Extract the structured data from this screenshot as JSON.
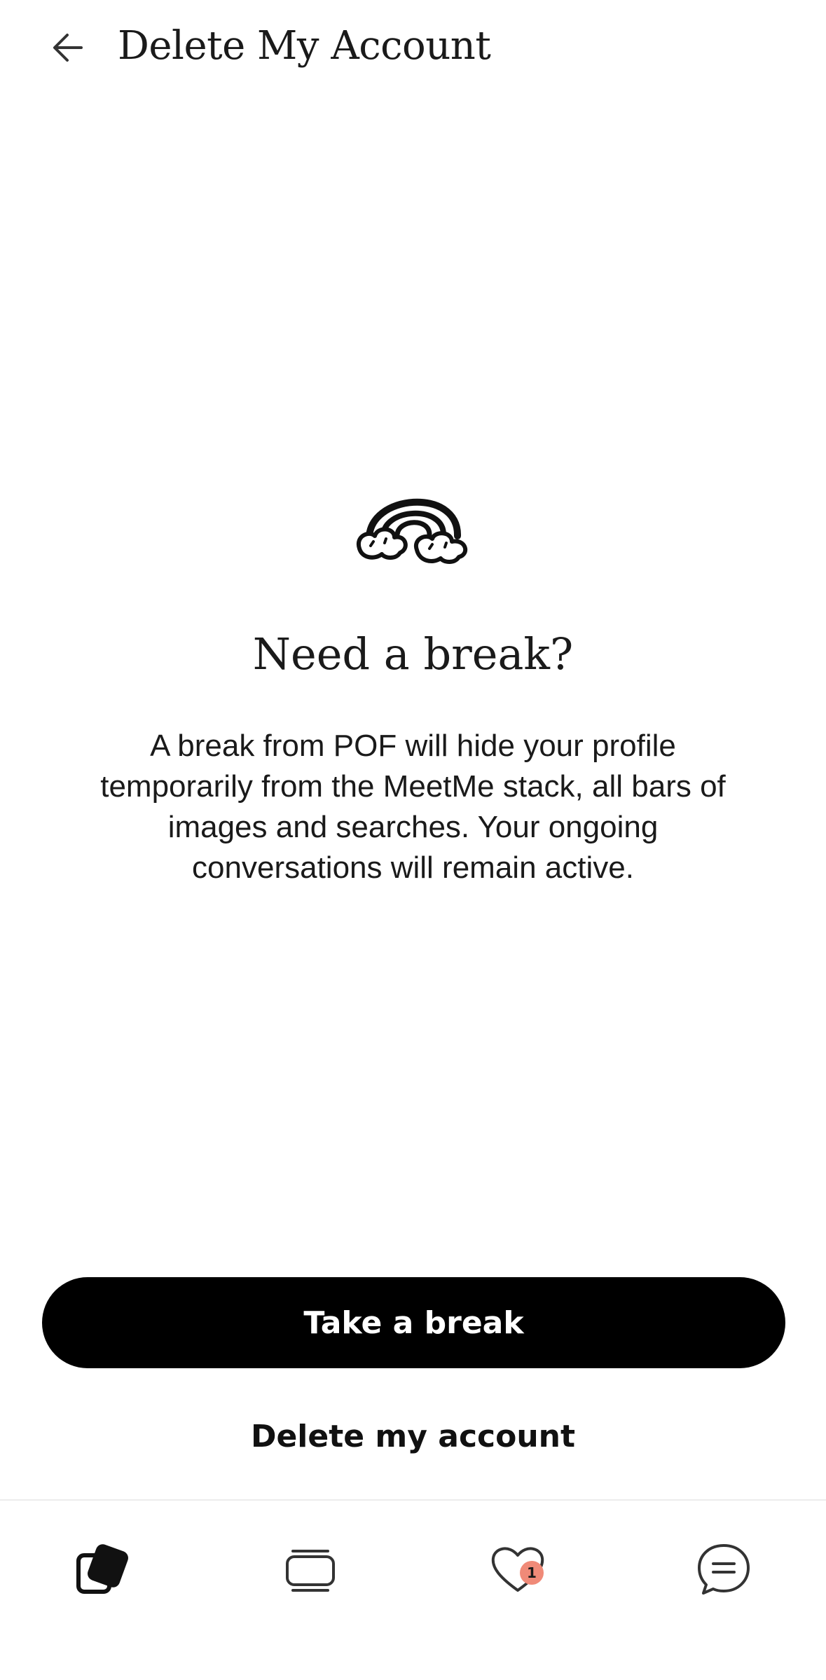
{
  "header": {
    "title": "Delete My Account",
    "back_icon": "arrow-left-icon"
  },
  "illustration": {
    "icon": "rainbow-icon"
  },
  "content": {
    "headline": "Need a break?",
    "body": "A break from POF will hide your profile temporarily from the MeetMe stack, all bars of images and searches. Your ongoing conversations will remain active."
  },
  "actions": {
    "primary_label": "Take a break",
    "secondary_label": "Delete my account"
  },
  "bottom_nav": {
    "items": [
      {
        "icon": "cards-icon",
        "active": true
      },
      {
        "icon": "stack-icon",
        "active": false
      },
      {
        "icon": "heart-icon",
        "active": false,
        "badge": "1"
      },
      {
        "icon": "chat-bubble-icon",
        "active": false
      }
    ]
  },
  "colors": {
    "primary_button_bg": "#000000",
    "primary_button_text": "#ffffff",
    "badge_bg": "#f08a78",
    "text": "#1a1a1a"
  }
}
